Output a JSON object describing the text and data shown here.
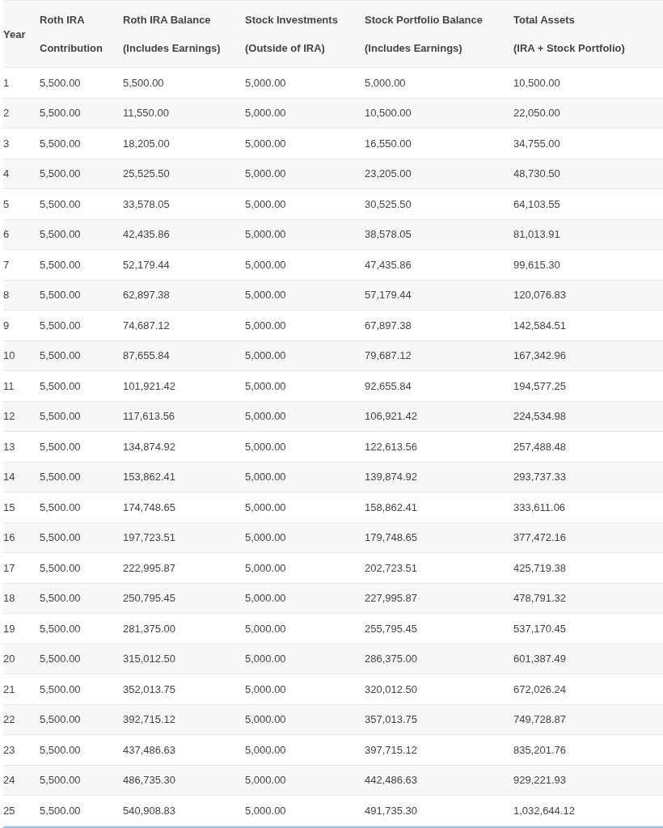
{
  "table": {
    "columns": [
      {
        "lines": [
          "Year"
        ]
      },
      {
        "lines": [
          "Roth IRA",
          "Contribution"
        ]
      },
      {
        "lines": [
          "Roth IRA Balance",
          "(Includes Earnings)"
        ]
      },
      {
        "lines": [
          "Stock Investments",
          "(Outside of IRA)"
        ]
      },
      {
        "lines": [
          "Stock Portfolio Balance",
          "(Includes Earnings)"
        ]
      },
      {
        "lines": [
          "Total Assets",
          "(IRA + Stock Portfolio)"
        ]
      }
    ],
    "rows": [
      [
        "1",
        "5,500.00",
        "5,500.00",
        "5,000.00",
        "5,000.00",
        "10,500.00"
      ],
      [
        "2",
        "5,500.00",
        "11,550.00",
        "5,000.00",
        "10,500.00",
        "22,050.00"
      ],
      [
        "3",
        "5,500.00",
        "18,205.00",
        "5,000.00",
        "16,550.00",
        "34,755.00"
      ],
      [
        "4",
        "5,500.00",
        "25,525.50",
        "5,000.00",
        "23,205.00",
        "48,730.50"
      ],
      [
        "5",
        "5,500.00",
        "33,578.05",
        "5,000.00",
        "30,525.50",
        "64,103.55"
      ],
      [
        "6",
        "5,500.00",
        "42,435.86",
        "5,000.00",
        "38,578.05",
        "81,013.91"
      ],
      [
        "7",
        "5,500.00",
        "52,179.44",
        "5,000.00",
        "47,435.86",
        "99,615.30"
      ],
      [
        "8",
        "5,500.00",
        "62,897.38",
        "5,000.00",
        "57,179.44",
        "120,076.83"
      ],
      [
        "9",
        "5,500.00",
        "74,687.12",
        "5,000.00",
        "67,897.38",
        "142,584.51"
      ],
      [
        "10",
        "5,500.00",
        "87,655.84",
        "5,000.00",
        "79,687.12",
        "167,342.96"
      ],
      [
        "11",
        "5,500.00",
        "101,921.42",
        "5,000.00",
        "92,655.84",
        "194,577.25"
      ],
      [
        "12",
        "5,500.00",
        "117,613.56",
        "5,000.00",
        "106,921.42",
        "224,534.98"
      ],
      [
        "13",
        "5,500.00",
        "134,874.92",
        "5,000.00",
        "122,613.56",
        "257,488.48"
      ],
      [
        "14",
        "5,500.00",
        "153,862.41",
        "5,000.00",
        "139,874.92",
        "293,737.33"
      ],
      [
        "15",
        "5,500.00",
        "174,748.65",
        "5,000.00",
        "158,862.41",
        "333,611.06"
      ],
      [
        "16",
        "5,500.00",
        "197,723.51",
        "5,000.00",
        "179,748.65",
        "377,472.16"
      ],
      [
        "17",
        "5,500.00",
        "222,995.87",
        "5,000.00",
        "202,723.51",
        "425,719.38"
      ],
      [
        "18",
        "5,500.00",
        "250,795.45",
        "5,000.00",
        "227,995.87",
        "478,791.32"
      ],
      [
        "19",
        "5,500.00",
        "281,375.00",
        "5,000.00",
        "255,795.45",
        "537,170.45"
      ],
      [
        "20",
        "5,500.00",
        "315,012.50",
        "5,000.00",
        "286,375.00",
        "601,387.49"
      ],
      [
        "21",
        "5,500.00",
        "352,013.75",
        "5,000.00",
        "320,012.50",
        "672,026.24"
      ],
      [
        "22",
        "5,500.00",
        "392,715.12",
        "5,000.00",
        "357,013.75",
        "749,728.87"
      ],
      [
        "23",
        "5,500.00",
        "437,486.63",
        "5,000.00",
        "397,715.12",
        "835,201.76"
      ],
      [
        "24",
        "5,500.00",
        "486,735.30",
        "5,000.00",
        "442,486.63",
        "929,221.93"
      ],
      [
        "25",
        "5,500.00",
        "540,908.83",
        "5,000.00",
        "491,735.30",
        "1,032,644.12"
      ]
    ]
  }
}
